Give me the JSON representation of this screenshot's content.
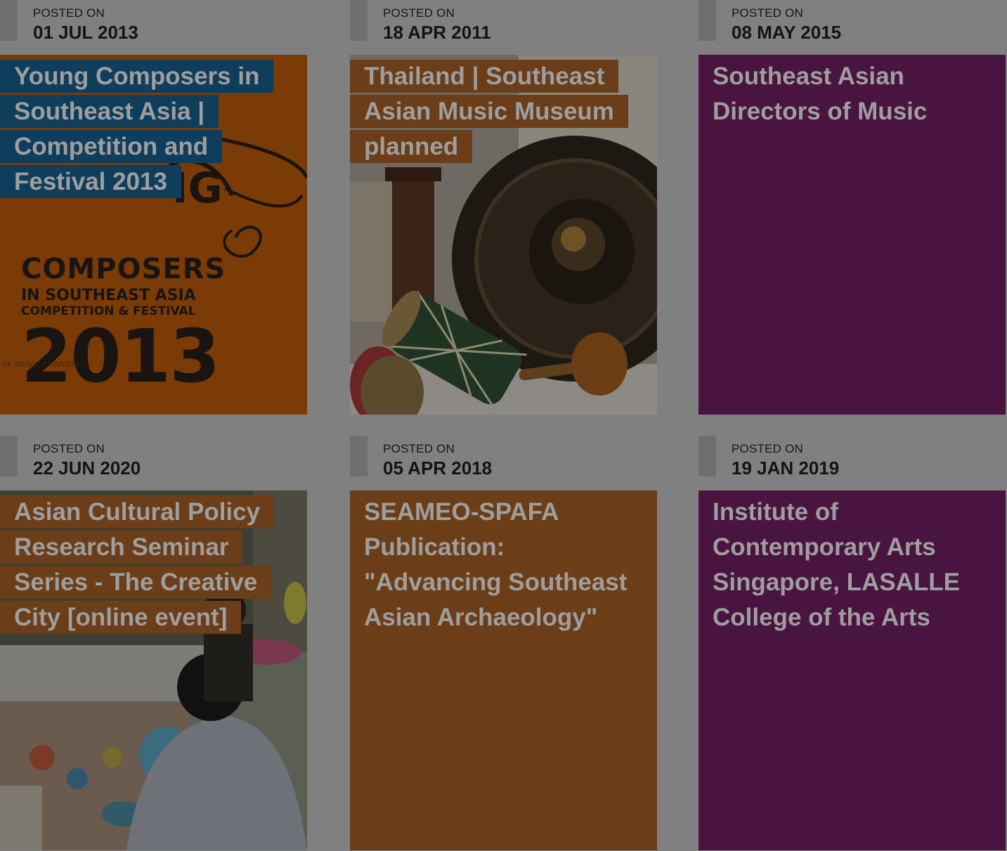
{
  "posts": [
    {
      "posted_label": "POSTED ON",
      "date": "01 JUL 2013",
      "title": "Young Composers in Southeast Asia | Competition and Festival 2013",
      "image": "poster",
      "label_color": "#0f3e5c",
      "poster": {
        "line1": "COMPOSERS",
        "line2": "IN SOUTHEAST ASIA",
        "line3": "COMPETITION & FESTIVAL",
        "year": "2013",
        "foot": "OF MUSIC / NIVERSITY"
      }
    },
    {
      "posted_label": "POSTED ON",
      "date": "18 APR 2011",
      "title": "Thailand | Southeast Asian Music Museum planned",
      "image": "instruments-photo",
      "label_color": "#6b3d18"
    },
    {
      "posted_label": "POSTED ON",
      "date": "08 MAY 2015",
      "title": "Southeast Asian Directors of Music",
      "image": "none",
      "tile_color": "#4a1440"
    },
    {
      "posted_label": "POSTED ON",
      "date": "22 JUN 2020",
      "title": "Asian Cultural Policy Research Seminar Series - The Creative City [online event]",
      "image": "workshop-photo",
      "label_color": "#6b3d18"
    },
    {
      "posted_label": "POSTED ON",
      "date": "05 APR 2018",
      "title": "SEAMEO-SPAFA Publication: \"Advancing Southeast Asian Archaeology\"",
      "image": "none",
      "tile_color": "#6b3e18"
    },
    {
      "posted_label": "POSTED ON",
      "date": "19 JAN 2019",
      "title": "Institute of Contemporary Arts Singapore, LASALLE College of the Arts",
      "image": "none",
      "tile_color": "#4a1440"
    }
  ]
}
